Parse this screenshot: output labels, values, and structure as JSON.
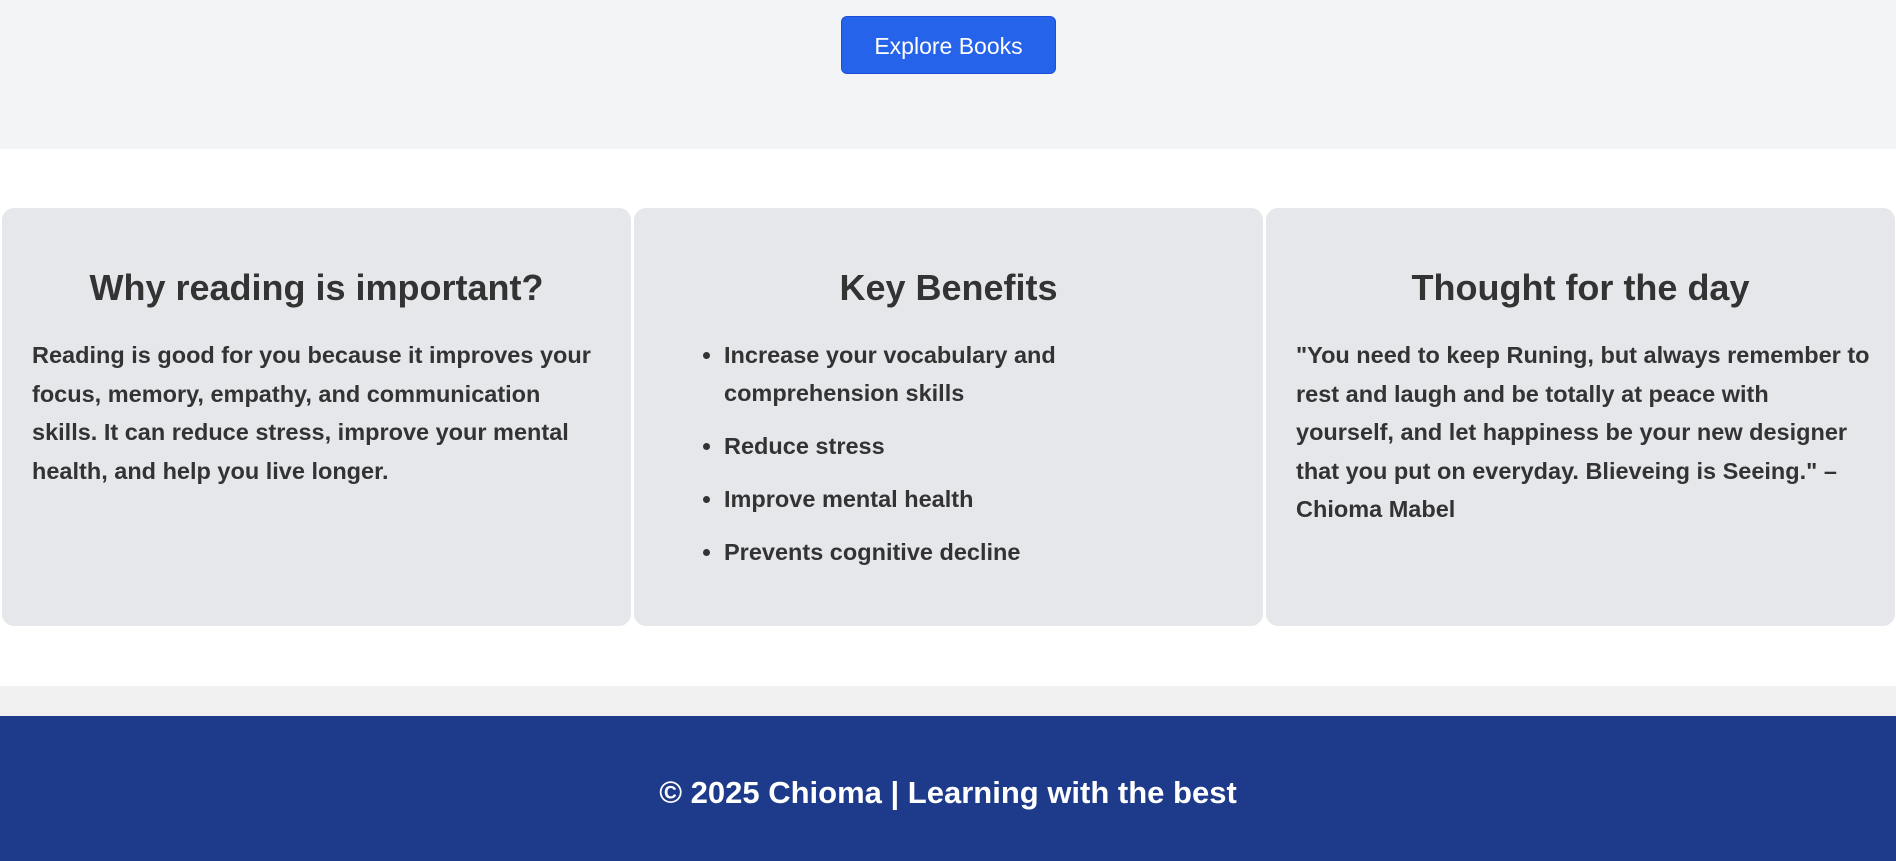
{
  "hero": {
    "explore_button_label": "Explore Books"
  },
  "cards": {
    "why_reading": {
      "title": "Why reading is important?",
      "body": "Reading is good for you because it improves your focus, memory, empathy, and communication skills. It can reduce stress, improve your mental health, and help you live longer."
    },
    "key_benefits": {
      "title": "Key Benefits",
      "items": [
        "Increase your vocabulary and comprehension skills",
        "Reduce stress",
        "Improve mental health",
        "Prevents cognitive decline"
      ]
    },
    "thought": {
      "title": "Thought for the day",
      "quote": "\"You need to keep Runing, but always remember to rest and laugh and be totally at peace with yourself, and let happiness be your new designer that you put on everyday. Blieveing is Seeing.\" – Chioma Mabel"
    }
  },
  "footer": {
    "text": "© 2025 Chioma | Learning with the best"
  },
  "colors": {
    "accent": "#2563eb",
    "footer_bg": "#1e3a8a",
    "card_bg": "#e5e7eb",
    "hero_bg": "#f3f4f6"
  }
}
